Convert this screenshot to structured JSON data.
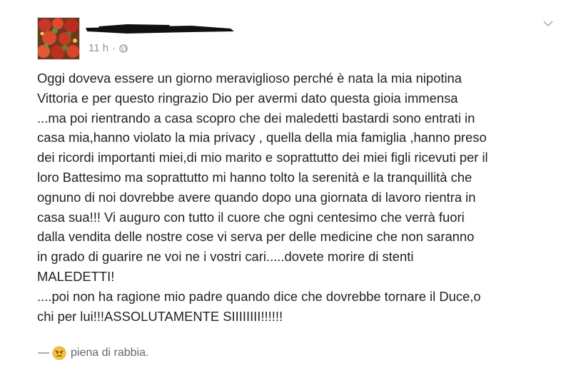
{
  "post": {
    "time": "11 h",
    "separator": "·",
    "privacy_icon": "globe-icon",
    "menu_icon": "chevron-down-icon",
    "lines": [
      "Oggi doveva essere un giorno meraviglioso perché è nata la mia nipotina",
      "Vittoria e per questo ringrazio Dio per avermi dato questa gioia immensa",
      "...ma poi rientrando a casa scopro che dei maledetti bastardi sono entrati in",
      "casa mia,hanno violato la mia privacy , quella della mia famiglia ,hanno preso",
      "dei ricordi importanti miei,di mio marito e soprattutto dei miei figli ricevuti per il",
      "loro Battesimo ma soprattutto mi hanno tolto la serenità e la tranquillità che",
      "ognuno di noi dovrebbe avere quando dopo una giornata di lavoro rientra in",
      "casa sua!!! Vi auguro con tutto il cuore che ogni centesimo che verrà fuori",
      "dalla vendita delle nostre cose vi serva per delle medicine che non saranno",
      "in grado di guarire ne voi ne i vostri cari.....dovete morire di stenti",
      "MALEDETTI!",
      "....poi non ha ragione mio padre quando dice che dovrebbe tornare il Duce,o",
      "chi per lui!!!ASSOLUTAMENTE SIIIIIIII!!!!!!"
    ],
    "feeling": {
      "dash": "—",
      "icon": "angry-face-icon",
      "text": "piena di rabbia."
    }
  },
  "colors": {
    "text": "#1d2129",
    "meta": "#90949c",
    "feeling": "#616770",
    "redaction": "#111111"
  }
}
